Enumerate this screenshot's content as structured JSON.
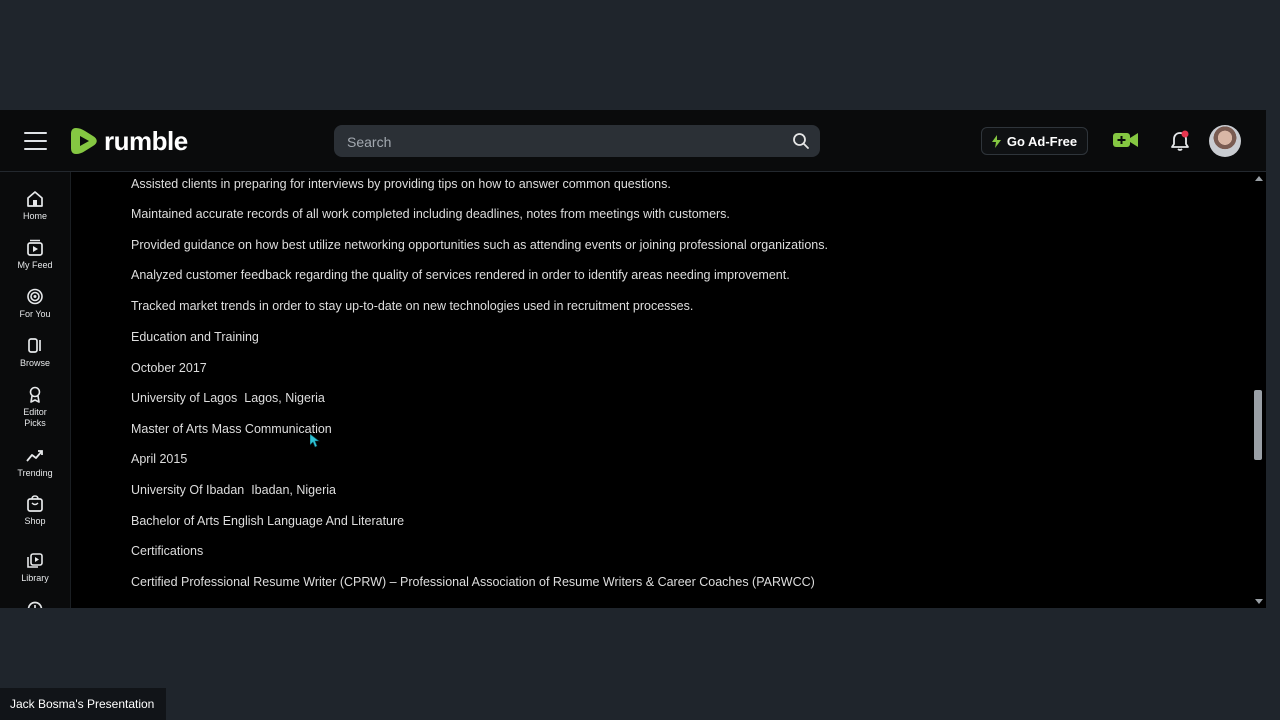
{
  "topbar": {
    "logo_text": "rumble",
    "search_placeholder": "Search",
    "ad_free_label": "Go Ad-Free"
  },
  "sidebar": {
    "items": [
      {
        "label": "Home",
        "icon": "home-icon"
      },
      {
        "label": "My Feed",
        "icon": "feed-icon"
      },
      {
        "label": "For You",
        "icon": "target-icon"
      },
      {
        "label": "Browse",
        "icon": "browse-icon"
      },
      {
        "label": "Editor Picks",
        "icon": "award-icon"
      },
      {
        "label": "Trending",
        "icon": "trending-icon"
      },
      {
        "label": "Shop",
        "icon": "shop-icon"
      },
      {
        "label": "Library",
        "icon": "library-icon"
      }
    ]
  },
  "content": {
    "lines": [
      "Assisted clients in preparing for interviews by providing tips on how to answer common questions.",
      "Maintained accurate records of all work completed including deadlines, notes from meetings with customers.",
      "Provided guidance on how best utilize networking opportunities such as attending events or joining professional organizations.",
      "Analyzed customer feedback regarding the quality of services rendered in order to identify areas needing improvement.",
      "Tracked market trends in order to stay up-to-date on new technologies used in recruitment processes.",
      "Education and Training",
      "October 2017",
      "University of Lagos  Lagos, Nigeria",
      "Master of Arts Mass Communication",
      "April 2015",
      "University Of Ibadan  Ibadan, Nigeria",
      "Bachelor of Arts English Language And Literature",
      "Certifications",
      "Certified Professional Resume Writer (CPRW) – Professional Association of Resume Writers & Career Coaches (PARWCC)"
    ]
  },
  "presenter_label": "Jack Bosma's Presentation",
  "colors": {
    "brand_green": "#85c742",
    "background": "#000000",
    "outer": "#1f252c"
  }
}
